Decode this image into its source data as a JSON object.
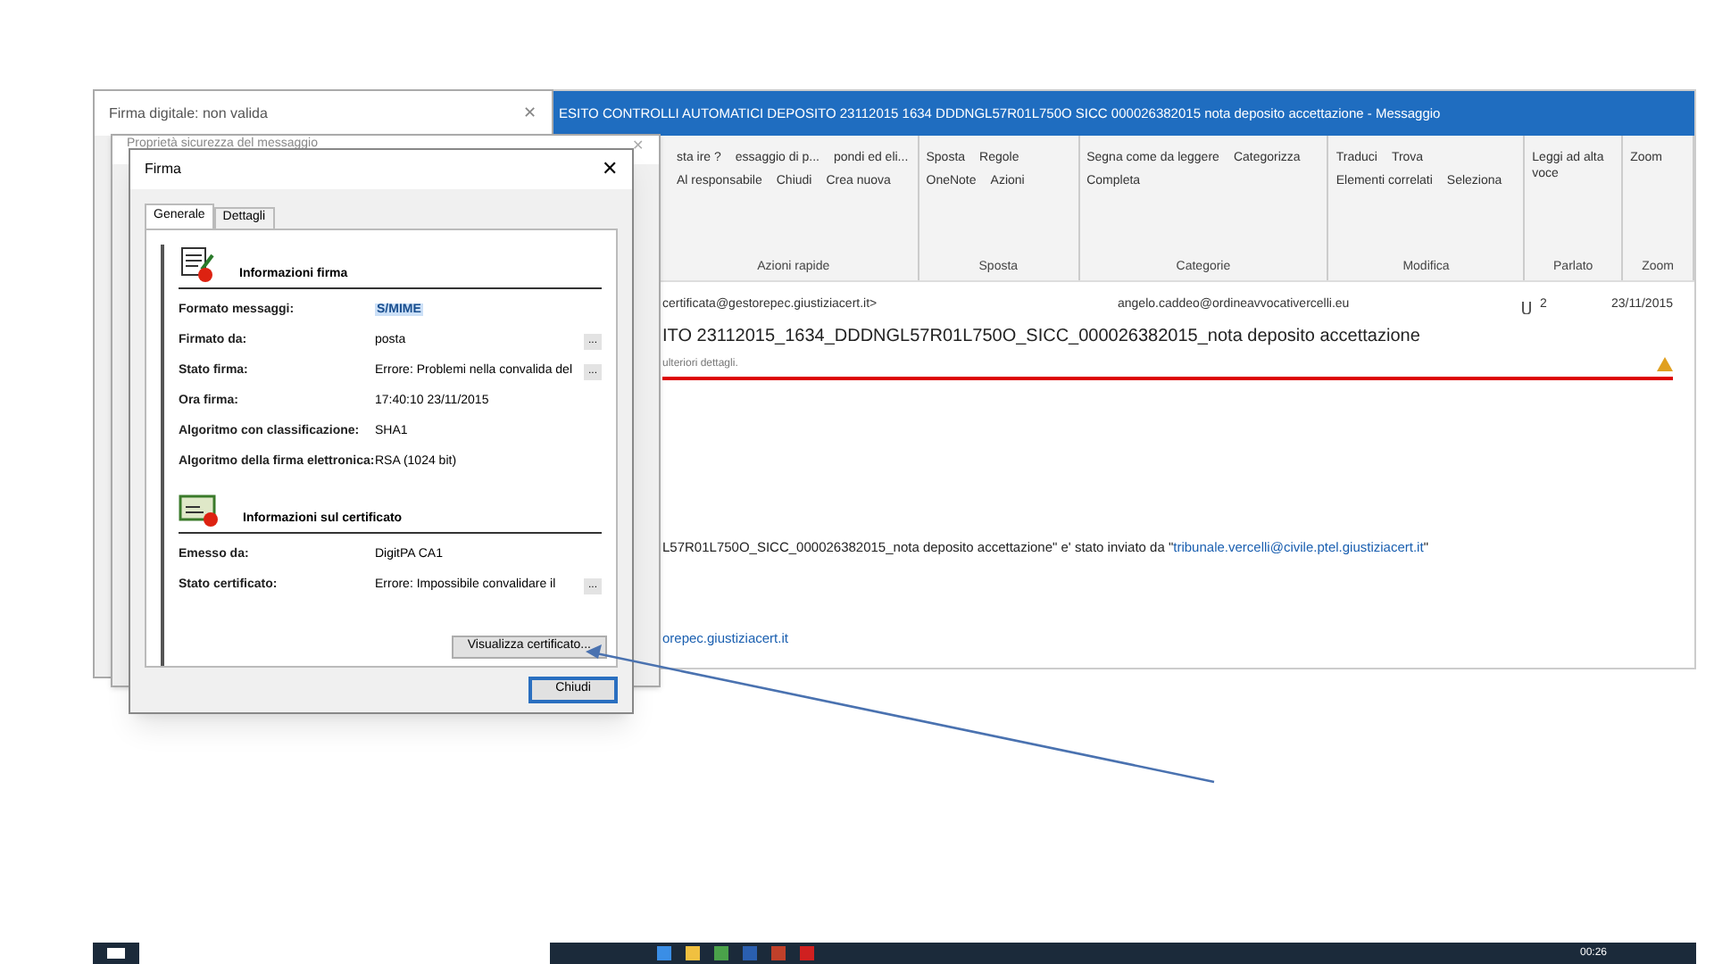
{
  "outlook": {
    "title": "ESITO CONTROLLI AUTOMATICI DEPOSITO 23112015 1634 DDDNGL57R01L750O SICC 000026382015 nota deposito accettazione - Messaggio",
    "ribbon_groups": [
      {
        "label": "Azioni rapide",
        "items": [
          "sta ire ?",
          "essaggio di p...",
          "pondi ed eli...",
          "Al responsabile",
          "Chiudi",
          "Crea nuova"
        ]
      },
      {
        "label": "Sposta",
        "items": [
          "Sposta",
          "Regole",
          "OneNote",
          "Azioni"
        ]
      },
      {
        "label": "Categorie",
        "items": [
          "Segna come da leggere",
          "Categorizza",
          "Completa"
        ]
      },
      {
        "label": "Modifica",
        "items": [
          "Traduci",
          "Trova",
          "Elementi correlati",
          "Seleziona"
        ]
      },
      {
        "label": "Parlato",
        "items": [
          "Leggi ad alta voce"
        ]
      },
      {
        "label": "Zoom",
        "items": [
          "Zoom"
        ]
      }
    ],
    "sender": "certificata@gestorepec.giustiziacert.it>",
    "recipient": "angelo.caddeo@ordineavvocativercelli.eu",
    "attachments": "2",
    "date": "23/11/2015",
    "subject": "ITO 23112015_1634_DDDNGL57R01L750O_SICC_000026382015_nota deposito accettazione",
    "info": "ulteriori dettagli.",
    "body_text": "L57R01L750O_SICC_000026382015_nota deposito accettazione\" e' stato inviato da \"",
    "body_link": "tribunale.vercelli@civile.ptel.giustiziacert.it",
    "body_end": "\"",
    "footer_link": "orepec.giustiziacert.it"
  },
  "back_dialog": {
    "title": "Firma digitale: non valida",
    "close": "✕"
  },
  "props_dialog": {
    "title": "Proprietà sicurezza del messaggio",
    "close": "✕"
  },
  "firma": {
    "title": "Firma",
    "close": "✕",
    "tabs": [
      {
        "label": "Generale",
        "selected": true
      },
      {
        "label": "Dettagli",
        "selected": false
      }
    ],
    "sections": [
      {
        "kind": "signature",
        "heading": "Informazioni firma",
        "rows": [
          {
            "label": "Formato messaggi:",
            "value": "S/MIME",
            "highlighted": true
          },
          {
            "label": "Firmato da:",
            "value": "posta",
            "highlighted": false,
            "more": "..."
          },
          {
            "label": "Stato firma:",
            "value": "Errore: Problemi nella convalida del",
            "highlighted": false,
            "more": "..."
          },
          {
            "label": "Ora firma:",
            "value": "17:40:10 23/11/2015",
            "highlighted": false
          },
          {
            "label": "Algoritmo con classificazione:",
            "value": "SHA1",
            "highlighted": false
          },
          {
            "label": "Algoritmo della firma elettronica:",
            "value": "RSA (1024 bit)",
            "highlighted": false
          }
        ]
      },
      {
        "kind": "certificate",
        "heading": "Informazioni sul certificato",
        "rows": [
          {
            "label": "Emesso da:",
            "value": "DigitPA CA1",
            "highlighted": false
          },
          {
            "label": "Stato certificato:",
            "value": "Errore: Impossibile convalidare il",
            "highlighted": false,
            "more": "..."
          }
        ]
      }
    ],
    "view_button": "Visualizza certificato...",
    "close_button": "Chiudi"
  },
  "taskbar": {
    "time": "00:26"
  }
}
